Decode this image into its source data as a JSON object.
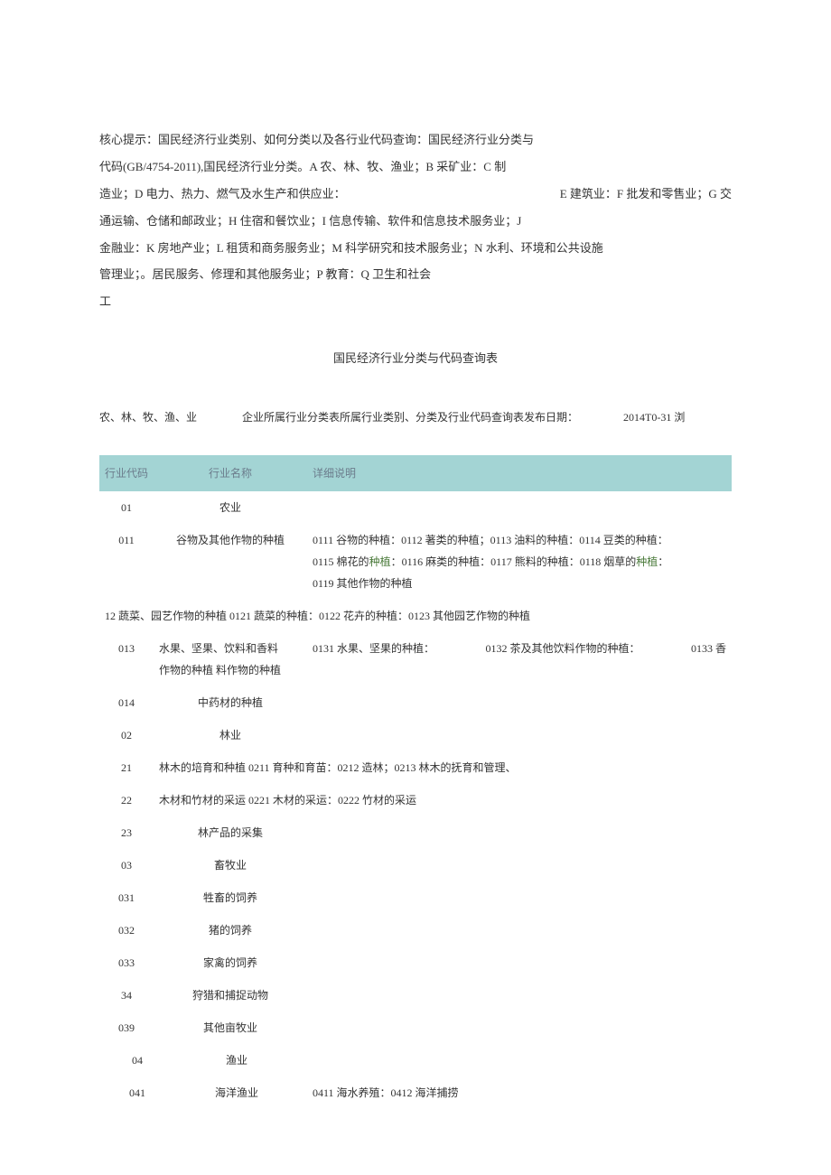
{
  "intro": {
    "line1_prefix": "核心提示：国民经济行业类别、如何分类以及各行业代码查询：国民经济行业分类与",
    "line2": "代码(GB/4754-2011),国民经济行业分类。A 农、林、牧、渔业；B 采矿业：C 制",
    "line3_left": "造业；D 电力、热力、燃气及水生产和供应业：",
    "line3_right": "E 建筑业：F 批发和零售业；G 交",
    "line4": "通运输、仓储和邮政业；H 住宿和餐饮业；I 信息传输、软件和信息技术服务业；J",
    "line5": "金融业：K 房地产业；L 租赁和商务服务业；M 科学研究和技术服务业；N 水利、环境和公共设施",
    "line6": "管理业；。居民服务、修理和其他服务业；P 教育：Q 卫生和社会",
    "line7": "工"
  },
  "section_title": "国民经济行业分类与代码查询表",
  "meta": {
    "cat": "农、林、牧、渔、业",
    "sub": "企业所属行业分类表所属行业类别、分类及行业代码查询表发布日期：",
    "date": "2014T0-31 浏"
  },
  "headers": {
    "code": "行业代码",
    "name": "行业名称",
    "detail": "详细说明"
  },
  "link_words": {
    "zhongzhi": "种植"
  },
  "rows": [
    {
      "code": "01",
      "name": "农业",
      "detail": ""
    },
    {
      "code": "011",
      "name": "谷物及其他作物的种植",
      "detail_lines": [
        "0111 谷物的种植：0112 著类的种植；0113 油料的种植：0114 豆类的种植：",
        "0115 棉花的{L}：0116 麻类的种植：0117 熊料的种植：0118 烟草的{L}：",
        "0119 其他作物的种植"
      ]
    },
    {
      "span": true,
      "text": "12 蔬菜、园艺作物的种植 0121 蔬菜的种植：0122 花卉的种植：0123 其他园艺作物的种植"
    },
    {
      "code": "013",
      "name_l1": "水果、坚果、饮料和香料",
      "name_l2": "作物的种植 料作物的种植",
      "detail_parts": [
        "0131 水果、坚果的种植：",
        "0132 茶及其他饮料作物的种植：",
        "0133 香"
      ]
    },
    {
      "code": "014",
      "name": "中药材的种植",
      "detail": ""
    },
    {
      "code": "02",
      "name": "林业",
      "detail": ""
    },
    {
      "code": "21",
      "name": "林木的培育和种植",
      "detail_inline": "0211 育种和育苗：0212 造林；0213 林木的抚育和管理、",
      "joined": true
    },
    {
      "code": "22",
      "name": "木材和竹材的采运",
      "detail_inline": "0221 木材的采运：0222 竹材的采运",
      "joined": true
    },
    {
      "code": "23",
      "name": "林产品的采集",
      "detail": ""
    },
    {
      "code": "03",
      "name": "畜牧业",
      "detail": ""
    },
    {
      "code": "031",
      "name": "牲畜的饲养",
      "detail": ""
    },
    {
      "code": "032",
      "name": "猪的饲养",
      "detail": ""
    },
    {
      "code": "033",
      "name": "家禽的饲养",
      "detail": ""
    },
    {
      "code": "34",
      "name": "狩猎和捕捉动物",
      "detail": ""
    },
    {
      "code": "039",
      "name": "其他亩牧业",
      "detail": ""
    },
    {
      "code": "04",
      "name": "渔业",
      "detail": "",
      "indent": true
    },
    {
      "code": "041",
      "name": "海洋渔业",
      "detail": "0411 海水养殖：0412 海洋捕捞",
      "indent": true
    }
  ]
}
